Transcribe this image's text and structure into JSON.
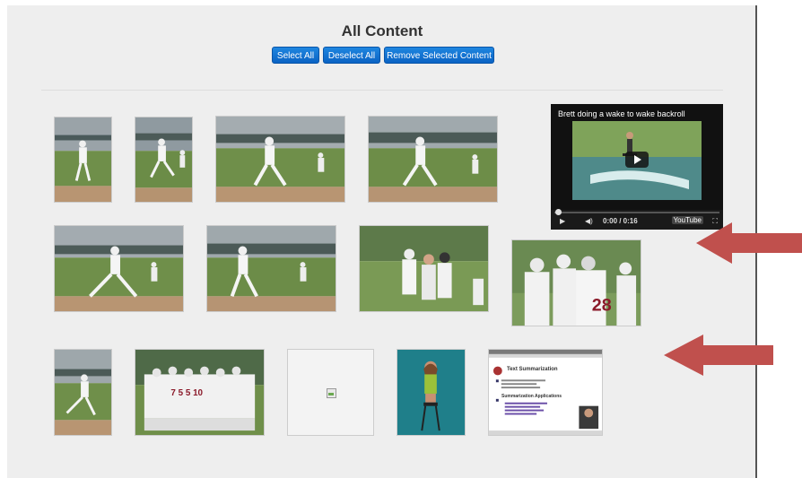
{
  "page": {
    "title": "All Content"
  },
  "toolbar": {
    "select_all_label": "Select All",
    "deselect_all_label": "Deselect All",
    "remove_selected_label": "Remove Selected Content"
  },
  "video": {
    "title": "Brett doing a wake to wake backroll",
    "time": "0:00 / 0:16",
    "brand": "YouTube",
    "progress": 0
  },
  "thumbnails": [
    {
      "row": 1,
      "kind": "photo",
      "subject": "baseball pitcher"
    },
    {
      "row": 1,
      "kind": "photo",
      "subject": "baseball pitcher"
    },
    {
      "row": 1,
      "kind": "photo",
      "subject": "baseball pitcher"
    },
    {
      "row": 1,
      "kind": "photo",
      "subject": "baseball pitcher"
    },
    {
      "row": 2,
      "kind": "photo",
      "subject": "baseball pitcher"
    },
    {
      "row": 2,
      "kind": "photo",
      "subject": "baseball pitcher"
    },
    {
      "row": 2,
      "kind": "photo",
      "subject": "players talking"
    },
    {
      "row": 2,
      "kind": "photo",
      "subject": "team huddle"
    },
    {
      "row": 3,
      "kind": "photo",
      "subject": "baseball pitcher"
    },
    {
      "row": 3,
      "kind": "photo",
      "subject": "team group"
    },
    {
      "row": 3,
      "kind": "broken-image",
      "subject": ""
    },
    {
      "row": 3,
      "kind": "photo",
      "subject": "person on stool"
    },
    {
      "row": 3,
      "kind": "slide",
      "subject": "text summarization slide"
    }
  ],
  "slide": {
    "heading": "Text Summarization",
    "section": "Summarization Applications"
  },
  "colors": {
    "button": "#0a63c4",
    "panel": "#eeeeee",
    "arrow": "#c0504d",
    "grass": "#6f8f4a",
    "dirt": "#b89572"
  },
  "icons": [
    "play-icon",
    "volume-icon",
    "fullscreen-icon",
    "broken-image-icon",
    "arrow-icon"
  ]
}
